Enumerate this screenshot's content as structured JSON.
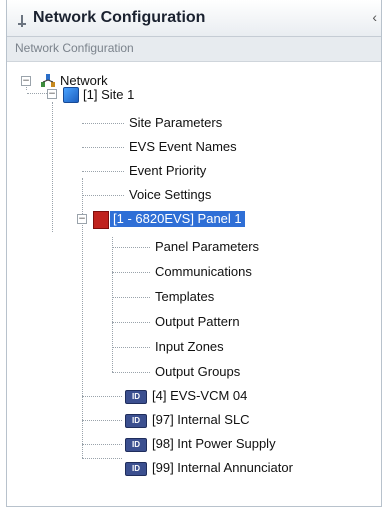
{
  "window": {
    "title": "Network Configuration",
    "subtitle": "Network Configuration",
    "close_glyph": "‹"
  },
  "tree": {
    "network": {
      "label": "Network",
      "icon": "network-icon"
    },
    "site": {
      "label": "[1] Site 1",
      "icon": "site-icon"
    },
    "site_children": [
      "Site Parameters",
      "EVS Event Names",
      "Event Priority",
      "Voice Settings"
    ],
    "panel": {
      "label": "[1 - 6820EVS] Panel 1",
      "icon": "panel-icon"
    },
    "panel_children": [
      "Panel Parameters",
      "Communications",
      "Templates",
      "Output Pattern",
      "Input Zones",
      "Output Groups"
    ],
    "devices": [
      "[4] EVS-VCM 04",
      "[97] Internal SLC",
      "[98] Int Power Supply",
      "[99] Internal Annunciator"
    ]
  },
  "colors": {
    "selection": "#2f6fd6",
    "panel_icon": "#c0231e",
    "device_icon": "#3b4f8f"
  }
}
